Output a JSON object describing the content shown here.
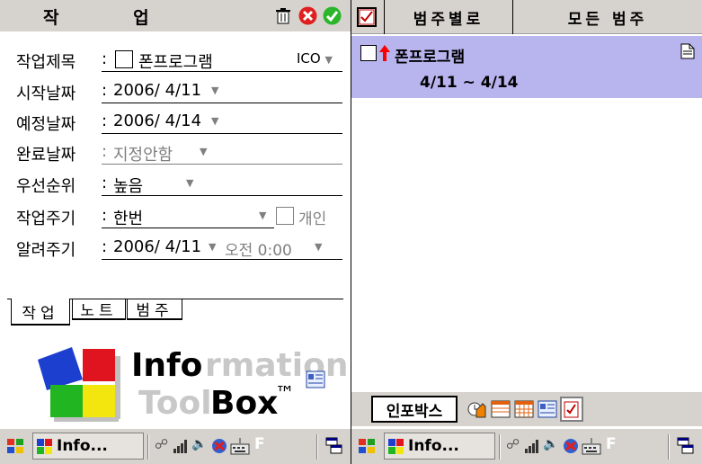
{
  "left": {
    "title": "작 업",
    "icons": {
      "delete": "trash-icon",
      "cancel": "close-red-icon",
      "ok": "check-green-icon"
    },
    "fields": {
      "subject_label": "작업제목",
      "subject_value": "폰프로그램",
      "subject_ico": "ICO",
      "start_label": "시작날짜",
      "start_value": "2006/ 4/11",
      "due_label": "예정날짜",
      "due_value": "2006/ 4/14",
      "complete_label": "완료날짜",
      "complete_value": "지정안함",
      "priority_label": "우선순위",
      "priority_value": "높음",
      "recur_label": "작업주기",
      "recur_value": "한번",
      "private_label": "개인",
      "remind_label": "알려주기",
      "remind_date": "2006/ 4/11",
      "remind_time": "오전 0:00",
      "colon": ":"
    },
    "tabs": [
      "작업",
      "노트",
      "범주"
    ],
    "logo": {
      "word1": "Info",
      "word1_faded": "rmation",
      "word2_faded": "Tool",
      "word2": "Box",
      "tm": "™"
    }
  },
  "right": {
    "header_filter": "범주별로",
    "header_category": "모든 범주",
    "task": {
      "title": "폰프로그램",
      "dates": "4/11 ~ 4/14"
    },
    "bottom": {
      "inbox_label": "인포박스"
    }
  },
  "taskbar": {
    "app_label": "Info...",
    "f_label": "F"
  },
  "colors": {
    "selection": "#b8b4ee",
    "chrome": "#d6d3ce",
    "priority_arrow": "#ff0000"
  }
}
